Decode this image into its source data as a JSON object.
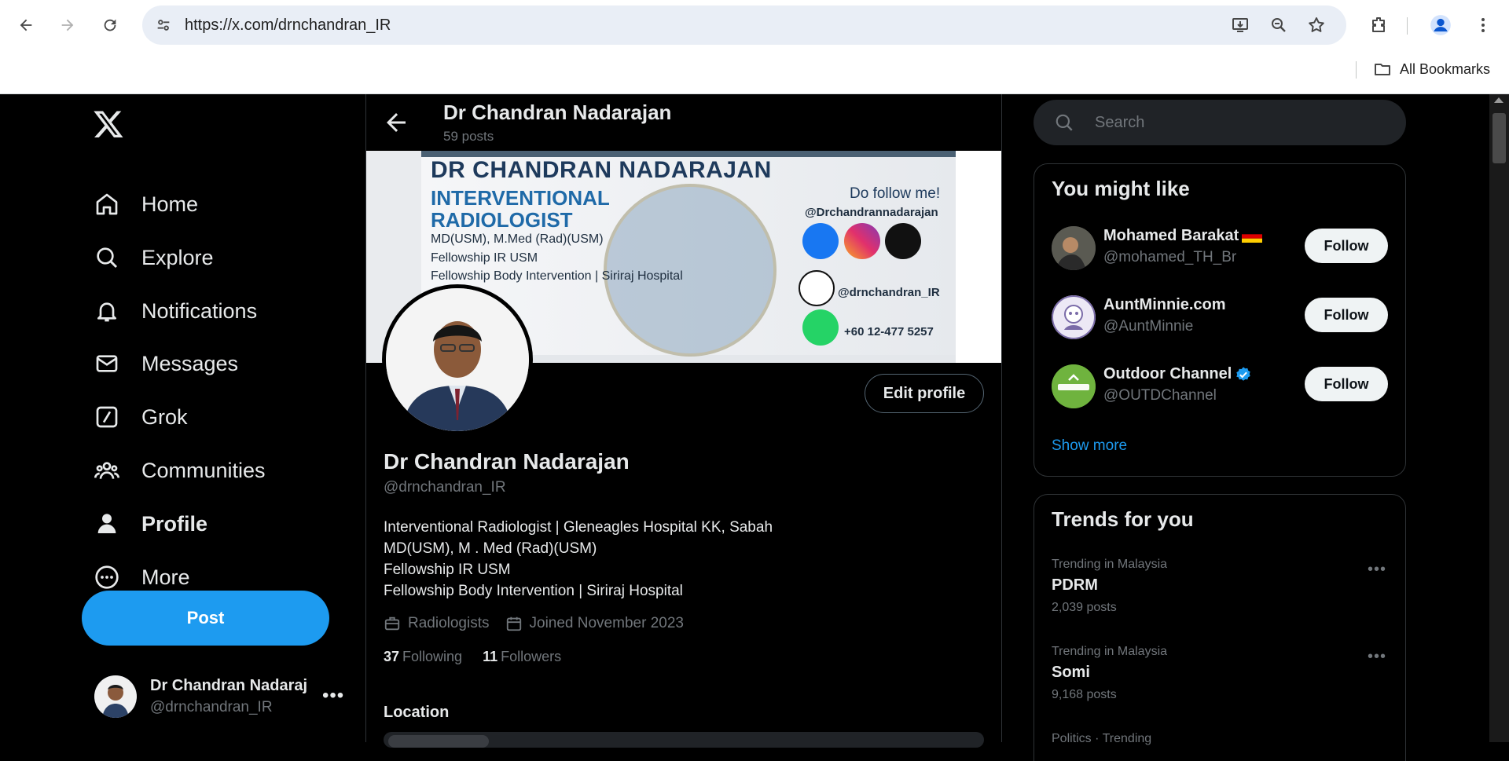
{
  "browser": {
    "url": "https://x.com/drnchandran_IR",
    "bookmarks_label": "All Bookmarks"
  },
  "nav": {
    "items": [
      {
        "label": "Home",
        "icon": "home-icon"
      },
      {
        "label": "Explore",
        "icon": "search-icon"
      },
      {
        "label": "Notifications",
        "icon": "bell-icon"
      },
      {
        "label": "Messages",
        "icon": "envelope-icon"
      },
      {
        "label": "Grok",
        "icon": "grok-icon"
      },
      {
        "label": "Communities",
        "icon": "people-icon"
      },
      {
        "label": "Profile",
        "icon": "person-icon"
      },
      {
        "label": "More",
        "icon": "more-circle-icon"
      }
    ],
    "post_label": "Post",
    "account": {
      "name": "Dr Chandran Nadaraj",
      "handle": "@drnchandran_IR"
    }
  },
  "header": {
    "title": "Dr Chandran Nadarajan",
    "posts": "59 posts"
  },
  "banner": {
    "title": "DR CHANDRAN NADARAJAN",
    "specialty": "INTERVENTIONAL RADIOLOGIST",
    "lines": [
      "MD(USM), M.Med (Rad)(USM)",
      "Fellowship IR USM",
      "Fellowship Body Intervention | Siriraj Hospital"
    ],
    "follow_text": "Do follow me!",
    "social_handle": "@Drchandrannadarajan",
    "x_handle": "@drnchandran_IR",
    "phone": "+60 12-477 5257"
  },
  "profile": {
    "edit_label": "Edit profile",
    "name": "Dr Chandran Nadarajan",
    "handle": "@drnchandran_IR",
    "bio": [
      "Interventional Radiologist | Gleneagles Hospital KK, Sabah",
      "MD(USM), M . Med (Rad)(USM)",
      "Fellowship IR USM",
      "Fellowship Body Intervention | Siriraj Hospital"
    ],
    "category": "Radiologists",
    "joined": "Joined November 2023",
    "following_count": "37",
    "following_label": "Following",
    "followers_count": "11",
    "followers_label": "Followers",
    "location_title": "Location"
  },
  "sidebar": {
    "search_placeholder": "Search",
    "you_might_like": "You might like",
    "suggestions": [
      {
        "name": "Mohamed Barakat",
        "handle": "@mohamed_TH_Br",
        "follow": "Follow",
        "flag": "germany-flag-icon"
      },
      {
        "name": "AuntMinnie.com",
        "handle": "@AuntMinnie",
        "follow": "Follow"
      },
      {
        "name": "Outdoor Channel",
        "handle": "@OUTDChannel",
        "follow": "Follow",
        "verified": true
      }
    ],
    "show_more": "Show more",
    "trends_title": "Trends for you",
    "trends": [
      {
        "context": "Trending in Malaysia",
        "topic": "PDRM",
        "count": "2,039 posts"
      },
      {
        "context": "Trending in Malaysia",
        "topic": "Somi",
        "count": "9,168 posts"
      },
      {
        "context": "Politics · Trending"
      }
    ]
  },
  "colors": {
    "accent": "#1d9bf0",
    "background": "#000000",
    "muted": "#71767b"
  }
}
